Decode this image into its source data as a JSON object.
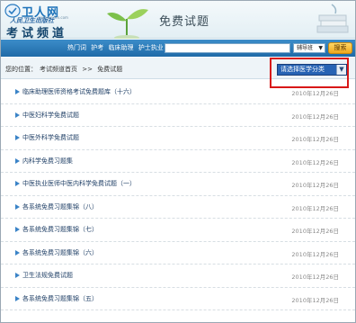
{
  "header": {
    "logo_name": "卫人网",
    "logo_url": "www.weiren.com",
    "logo_slogan": "人民卫生出版社",
    "logo_channel": "考试频道",
    "banner_title": "免费试题"
  },
  "nav": {
    "links": [
      "热门词",
      "护考",
      "临床助理",
      "护士执业"
    ],
    "search_placeholder": "",
    "tutor_select": "辅导班",
    "search_button": "搜索"
  },
  "breadcrumb": {
    "prefix": "您的位置：",
    "home": "考试频道首页",
    "separator": ">>",
    "current": "免费试题"
  },
  "category_select": {
    "value": "请选择医学分类"
  },
  "articles": [
    {
      "title": "临床助理医师资格考试免费题库（十六）",
      "date": "2010年12月26日"
    },
    {
      "title": "中医妇科学免费试题",
      "date": "2010年12月26日"
    },
    {
      "title": "中医外科学免费试题",
      "date": "2010年12月26日"
    },
    {
      "title": "内科学免费习题集",
      "date": "2010年12月26日"
    },
    {
      "title": "中医执业医师中医内科学免费试题（一）",
      "date": "2010年12月26日"
    },
    {
      "title": "各系统免费习题集锦（八）",
      "date": "2010年12月26日"
    },
    {
      "title": "各系统免费习题集锦（七）",
      "date": "2010年12月26日"
    },
    {
      "title": "各系统免费习题集锦（六）",
      "date": "2010年12月26日"
    },
    {
      "title": "卫生法规免费试题",
      "date": "2010年12月26日"
    },
    {
      "title": "各系统免费习题集锦（五）",
      "date": "2010年12月26日"
    }
  ]
}
